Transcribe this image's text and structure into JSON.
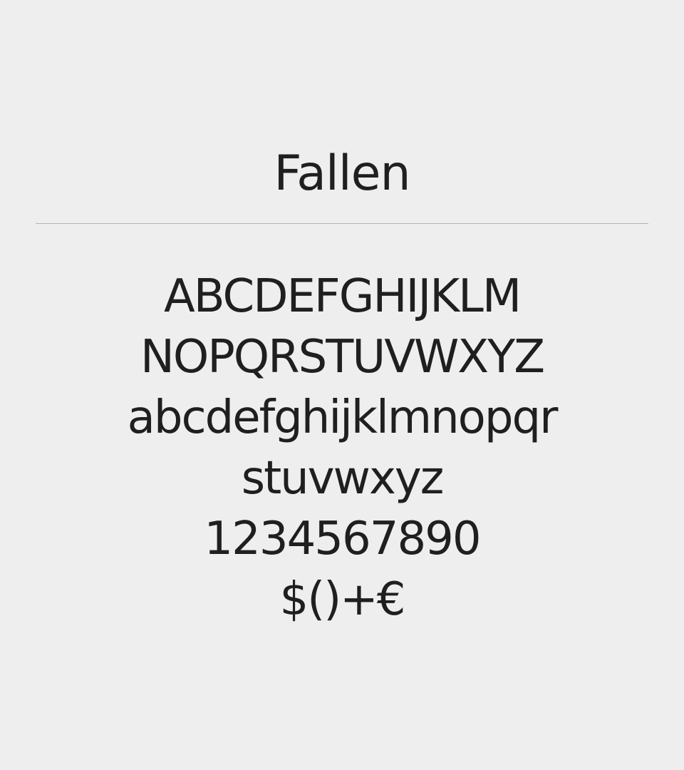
{
  "specimen": {
    "font_name": "Fallen",
    "lines": [
      "ABCDEFGHIJKLM",
      "NOPQRSTUVWXYZ",
      "abcdefghijklmnopqr",
      "stuvwxyz",
      "1234567890",
      "$()+€"
    ]
  },
  "colors": {
    "background": "#eeeeee",
    "text": "#1f1f1f",
    "divider": "#b4b4b4"
  }
}
